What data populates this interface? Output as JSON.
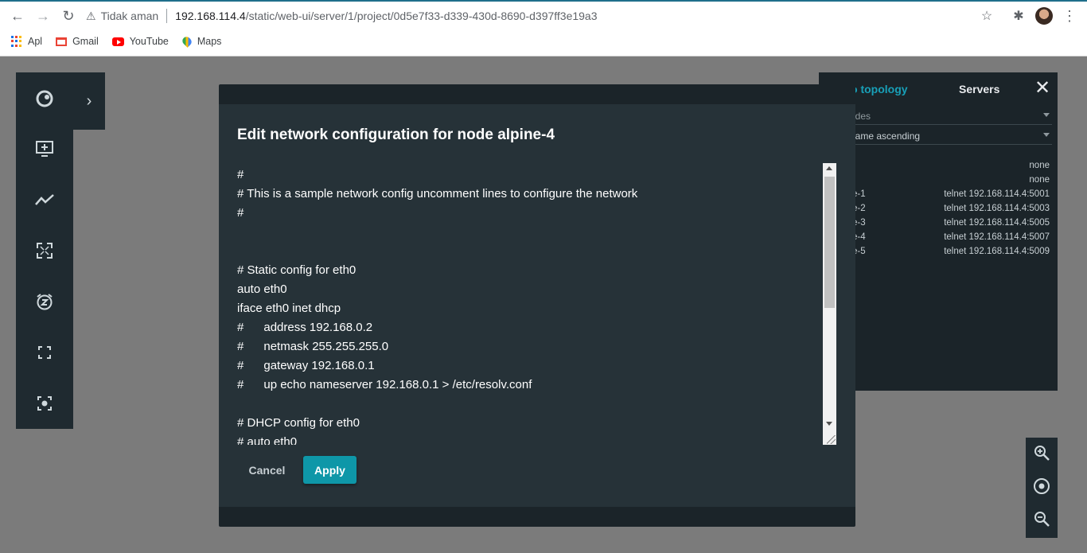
{
  "browser": {
    "not_secure_label": "Tidak aman",
    "url_host": "192.168.114.4",
    "url_path": "/static/web-ui/server/1/project/0d5e7f33-d339-430d-8690-d397ff3e19a3",
    "bookmarks": [
      {
        "label": "Apl",
        "icon": "apps-icon"
      },
      {
        "label": "Gmail",
        "icon": "gmail-icon"
      },
      {
        "label": "YouTube",
        "icon": "youtube-icon"
      },
      {
        "label": "Maps",
        "icon": "maps-icon"
      }
    ]
  },
  "toolbar": {
    "icons": [
      "gns3-logo-icon",
      "add-monitor-icon",
      "line-chart-icon",
      "fit-screen-icon",
      "snooze-icon",
      "fullscreen-icon",
      "screenshot-icon"
    ]
  },
  "side_panel": {
    "tab_topology": "Topology",
    "tab_topology_visible": "o topology",
    "tab_servers": "Servers",
    "filter_label": "odes",
    "sort_label": "name ascending",
    "rows": [
      {
        "name": "",
        "console": "none"
      },
      {
        "name": "",
        "console": "none"
      },
      {
        "name": "e-1",
        "console": "telnet 192.168.114.4:5001"
      },
      {
        "name": "e-2",
        "console": "telnet 192.168.114.4:5003"
      },
      {
        "name": "e-3",
        "console": "telnet 192.168.114.4:5005"
      },
      {
        "name": "e-4",
        "console": "telnet 192.168.114.4:5007"
      },
      {
        "name": "e-5",
        "console": "telnet 192.168.114.4:5009"
      }
    ]
  },
  "dialog": {
    "title": "Edit network configuration for node alpine-4",
    "lines": [
      "#",
      "# This is a sample network config uncomment lines to configure the network",
      "#",
      "",
      "",
      "# Static config for eth0",
      "auto eth0",
      "iface eth0 inet dhcp",
      "#      address 192.168.0.2",
      "#      netmask 255.255.255.0",
      "#      gateway 192.168.0.1",
      "#      up echo nameserver 192.168.0.1 > /etc/resolv.conf",
      "",
      "# DHCP config for eth0",
      "# auto eth0"
    ],
    "cancel_label": "Cancel",
    "apply_label": "Apply"
  },
  "colors": {
    "accent": "#0e97a8",
    "dialog_bg": "#263238",
    "panel_bg": "#1b2429",
    "topology_tab": "#18a0b8"
  }
}
